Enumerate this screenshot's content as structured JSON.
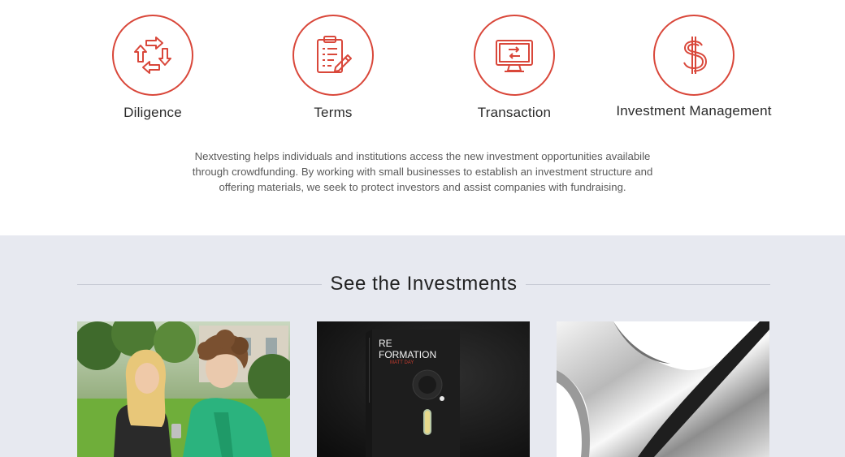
{
  "features": [
    {
      "label": "Diligence",
      "icon": "cycle-arrows-icon"
    },
    {
      "label": "Terms",
      "icon": "clipboard-pencil-icon"
    },
    {
      "label": "Transaction",
      "icon": "monitor-transfer-icon"
    },
    {
      "label": "Investment Management",
      "icon": "dollar-sign-icon"
    }
  ],
  "intro_text": "Nextvesting helps individuals and institutions access the new investment opportunities availabile through crowdfunding. By working with small businesses to establish an investment structure and offering materials, we seek to protect investors and assist companies with fundraising.",
  "investments": {
    "title": "See the Investments",
    "cards": [
      {
        "image": "two-people-looking-at-phone"
      },
      {
        "image": "reformation-book-cover",
        "book_title_line1": "RE",
        "book_title_line2": "FORMATION",
        "book_author": "MATT DAY"
      },
      {
        "image": "chrome-abstract-shape"
      }
    ]
  },
  "colors": {
    "accent": "#d9473a",
    "section_bg": "#e7e9f0",
    "text": "#2b2b2b"
  }
}
